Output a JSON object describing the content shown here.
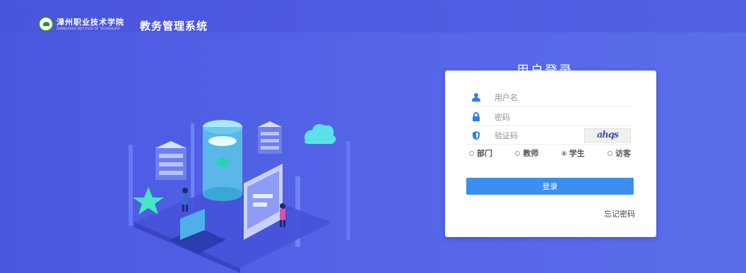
{
  "header": {
    "school_name_cn": "漳州职业技术学院",
    "school_name_en": "ZHANGZHOU INSTITUTE OF TECHNOLOGY",
    "system_title": "教务管理系统"
  },
  "login": {
    "title": "用户登录",
    "username_placeholder": "用户名",
    "password_placeholder": "密码",
    "captcha_placeholder": "验证码",
    "captcha_text": "ahqs",
    "roles": [
      {
        "label": "部门",
        "selected": false
      },
      {
        "label": "教师",
        "selected": false
      },
      {
        "label": "学生",
        "selected": true
      },
      {
        "label": "访客",
        "selected": false
      }
    ],
    "submit_label": "登录",
    "forgot_label": "忘记密码"
  },
  "colors": {
    "background": "#5060e4",
    "button": "#3a8ff0",
    "icon": "#2f7de6"
  }
}
